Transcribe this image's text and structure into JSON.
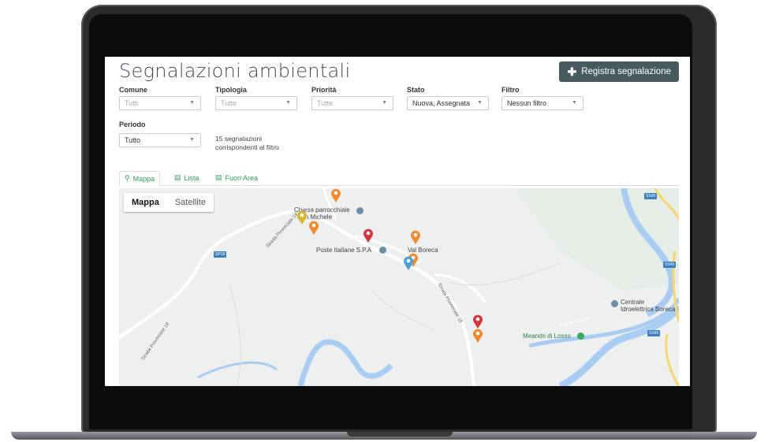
{
  "header": {
    "title": "Segnalazioni ambientali",
    "cta_label": "Registra segnalazione"
  },
  "filters": [
    {
      "label": "Comune",
      "value": "Tutti",
      "filled": false
    },
    {
      "label": "Tipologia",
      "value": "Tutte",
      "filled": false
    },
    {
      "label": "Priorità",
      "value": "Tutte",
      "filled": false
    },
    {
      "label": "Stato",
      "value": "Nuova, Assegnata",
      "filled": true
    },
    {
      "label": "Filtro",
      "value": "Nessun filtro",
      "filled": true
    }
  ],
  "period": {
    "label": "Periodo",
    "value": "Tutto"
  },
  "result_count": {
    "line1": "15 segnalazioni",
    "line2": "corrispondenti al filtro"
  },
  "tabs": [
    {
      "label": "Mappa",
      "icon": "map-marker-icon",
      "active": true
    },
    {
      "label": "Lista",
      "icon": "list-icon",
      "active": false
    },
    {
      "label": "Fuori Area",
      "icon": "list-icon",
      "active": false
    }
  ],
  "map": {
    "type_control": {
      "map": "Mappa",
      "satellite": "Satellite"
    },
    "labels": {
      "chiesa1": "Chiesa parrocchiale",
      "chiesa2": "San Michele",
      "poste": "Poste Italiane S.P.A",
      "valboreca": "Val Boreca",
      "centrale1": "Centrale",
      "centrale2": "Idroelettrica Boreca",
      "meandri": "Meandri di Losso",
      "fiume": "Fiume Trebbia",
      "sp1": "Strada Provinciale 18",
      "sp2": "Strada Provinciale 18",
      "sp3": "Strada Provinciale 18",
      "sp18": "SP18",
      "ss45a": "SS45",
      "ss45b": "SS45",
      "ss45c": "SS45"
    },
    "pin_colors": {
      "orange": "#ef8b2c",
      "red": "#d6343a",
      "yellow": "#d9b62e",
      "blue": "#4aa3d6"
    }
  },
  "colors": {
    "accent_green": "#2e9e5a",
    "cta_bg": "#465a5f",
    "water": "#a9cdf2"
  }
}
